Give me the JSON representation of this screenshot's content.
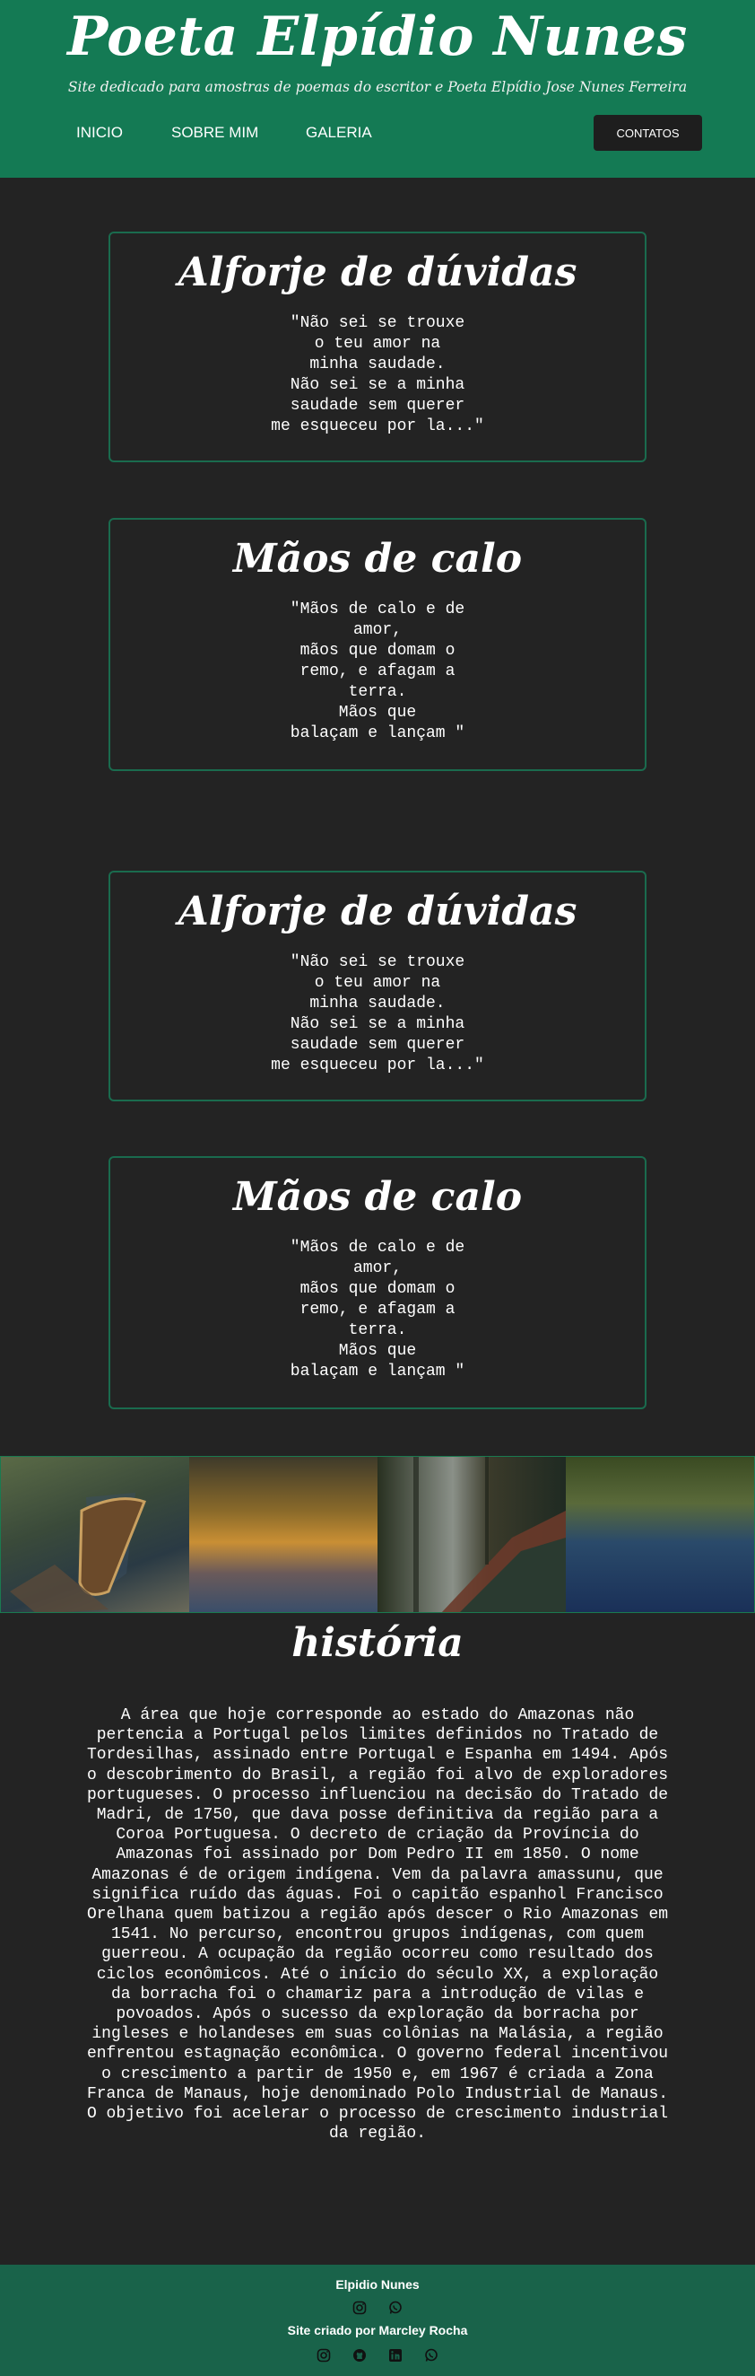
{
  "header": {
    "title": "Poeta Elpídio Nunes",
    "subtitle": "Site dedicado para amostras de poemas do escritor e Poeta Elpídio Jose Nunes Ferreira",
    "nav": [
      {
        "label": "INICIO"
      },
      {
        "label": "SOBRE MIM"
      },
      {
        "label": "GALERIA"
      }
    ],
    "contact_label": "CONTATOS"
  },
  "poems": [
    {
      "title": "Alforje de dúvidas",
      "text": "\"Não sei se trouxe\no teu amor na\nminha saudade.\nNão sei se a minha\nsaudade sem querer\nme esqueceu por la...\""
    },
    {
      "title": "Mãos de calo",
      "text": "\"Mãos de calo e de\namor,\nmãos que domam o\nremo, e afagam a\nterra.\nMãos que\nbalaçam e lançam \""
    },
    {
      "title": "Alforje de dúvidas",
      "text": "\"Não sei se trouxe\no teu amor na\nminha saudade.\nNão sei se a minha\nsaudade sem querer\nme esqueceu por la...\""
    },
    {
      "title": "Mãos de calo",
      "text": "\"Mãos de calo e de\namor,\nmãos que domam o\nremo, e afagam a\nterra.\nMãos que\nbalaçam e lançam \""
    }
  ],
  "history": {
    "title": "história",
    "text": "A área que hoje corresponde ao estado do Amazonas não pertencia a Portugal pelos limites definidos no Tratado de Tordesilhas, assinado entre Portugal e Espanha em 1494. Após o descobrimento do Brasil, a região foi alvo de exploradores portugueses. O processo influenciou na decisão do Tratado de Madri, de 1750, que dava posse definitiva da região para a Coroa Portuguesa. O decreto de criação da Província do Amazonas foi assinado por Dom Pedro II em 1850. O nome Amazonas é de origem indígena. Vem da palavra amassunu, que significa ruído das águas. Foi o capitão espanhol Francisco Orelhana quem batizou a região após descer o Rio Amazonas em 1541. No percurso, encontrou grupos indígenas, com quem guerreou. A ocupação da região ocorreu como resultado dos ciclos econômicos. Até o início do século XX, a exploração da borracha foi o chamariz para a introdução de vilas e povoados. Após o sucesso da exploração da borracha por ingleses e holandeses em suas colônias na Malásia, a região enfrentou estagnação econômica. O governo federal incentivou o crescimento a partir de 1950 e, em 1967 é criada a Zona Franca de Manaus, hoje denominado Polo Industrial de Manaus. O objetivo foi acelerar o processo de crescimento industrial da região."
  },
  "footer": {
    "name": "Elpidio Nunes",
    "credit": "Site criado por Marcley Rocha",
    "author_social_icons": [
      "instagram-icon",
      "whatsapp-icon"
    ],
    "creator_social_icons": [
      "instagram-icon",
      "github-icon",
      "linkedin-icon",
      "whatsapp-icon"
    ]
  },
  "colors": {
    "header_bg": "#147a54",
    "page_bg": "#232323",
    "card_border": "#1a6b4e",
    "footer_bg": "#19634a",
    "button_bg": "#1e1e1e"
  }
}
